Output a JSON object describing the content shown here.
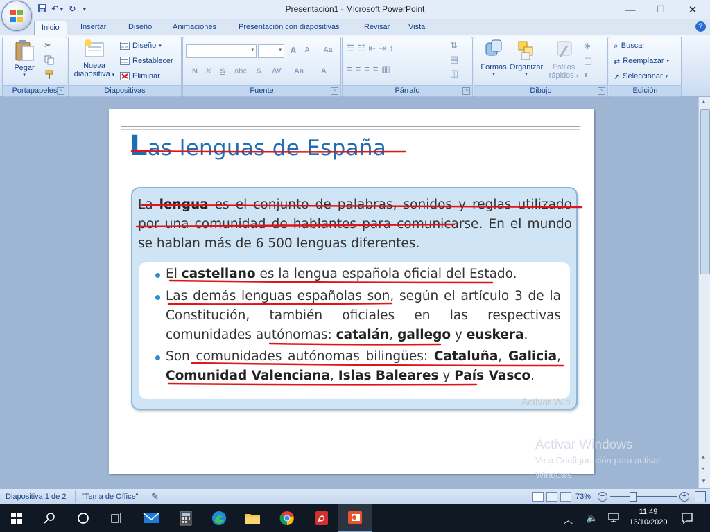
{
  "window": {
    "title": "Presentación1 - Microsoft PowerPoint",
    "minimize": "—",
    "maximize": "❐",
    "close": "✕"
  },
  "tabs": [
    {
      "label": "Inicio",
      "active": true
    },
    {
      "label": "Insertar"
    },
    {
      "label": "Diseño"
    },
    {
      "label": "Animaciones"
    },
    {
      "label": "Presentación con diapositivas"
    },
    {
      "label": "Revisar"
    },
    {
      "label": "Vista"
    }
  ],
  "ribbon": {
    "clipboard": {
      "label": "Portapapeles",
      "paste": "Pegar"
    },
    "slides": {
      "label": "Diapositivas",
      "new_slide": "Nueva",
      "new_slide2": "diapositiva",
      "layout": "Diseño",
      "reset": "Restablecer",
      "delete": "Eliminar"
    },
    "font": {
      "label": "Fuente",
      "font_name": "",
      "font_size": "",
      "bold": "N",
      "italic": "K",
      "underline": "S",
      "strike": "abc",
      "shadow": "S",
      "spacing": "AV",
      "case": "Aa",
      "color": "A",
      "grow": "A",
      "shrink": "A"
    },
    "paragraph": {
      "label": "Párrafo"
    },
    "drawing": {
      "label": "Dibujo",
      "shapes": "Formas",
      "arrange": "Organizar",
      "quick_styles": "Estilos",
      "quick_styles2": "rápidos"
    },
    "editing": {
      "label": "Edición",
      "find": "Buscar",
      "replace": "Reemplazar",
      "select": "Seleccionar"
    }
  },
  "slide": {
    "title_cap": "L",
    "title_rest": "as lenguas de España",
    "intro_1": "La ",
    "intro_bold": "lengua",
    "intro_2": " es el conjunto de palabras, sonidos y reglas utilizado por una comunidad de hablantes para comunicarse. En el mundo se hablan más de 6 500 lenguas diferentes.",
    "items": [
      {
        "pre": "El ",
        "bold": "castellano",
        "post": " es la lengua española oficial del Estado."
      },
      {
        "pre": "Las demás lenguas españolas son, según el artículo 3 de la Constitución, también oficiales en las respectivas comunidades autónomas: ",
        "bold": "catalán",
        "mid1": ", ",
        "bold2": "gallego",
        "mid2": " y ",
        "bold3": "euskera",
        "post": "."
      },
      {
        "pre": "Son comunidades autónomas bilingües: ",
        "bold": "Cataluña",
        "mid1": ", ",
        "bold2": "Galicia",
        "mid2": ", ",
        "bold3": "Comunidad Valenciana",
        "mid3": ", ",
        "bold4": "Islas Baleares",
        "mid4": " y ",
        "bold5": "País Vasco",
        "post": "."
      }
    ],
    "watermark_inner": "Activar Win"
  },
  "watermark": {
    "title": "Activar Windows",
    "line1": "Ve a Configuración para activar",
    "line2": "Windows."
  },
  "statusbar": {
    "slide_info": "Diapositiva 1 de 2",
    "theme": "\"Tema de Office\"",
    "zoom": "73%"
  },
  "taskbar": {
    "time": "11:49",
    "date": "13/10/2020"
  },
  "colors": {
    "accent": "#1a6fb5",
    "annotation": "#e0151b",
    "bullet": "#2d8fd3"
  }
}
